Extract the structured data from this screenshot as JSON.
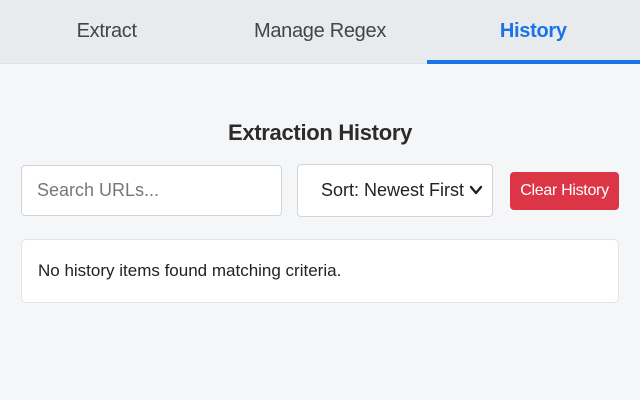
{
  "tabs": [
    {
      "label": "Extract",
      "active": false
    },
    {
      "label": "Manage Regex",
      "active": false
    },
    {
      "label": "History",
      "active": true
    }
  ],
  "history": {
    "title": "Extraction History",
    "search": {
      "placeholder": "Search URLs...",
      "value": ""
    },
    "sort": {
      "selected": "Sort: Newest First",
      "icon": "chevron-down-icon"
    },
    "clear_label": "Clear History",
    "empty_message": "No history items found matching criteria."
  },
  "colors": {
    "accent": "#1a73e8",
    "danger": "#dc3545",
    "tab_bar": "#e8ebee",
    "background": "#f5f6f8"
  }
}
